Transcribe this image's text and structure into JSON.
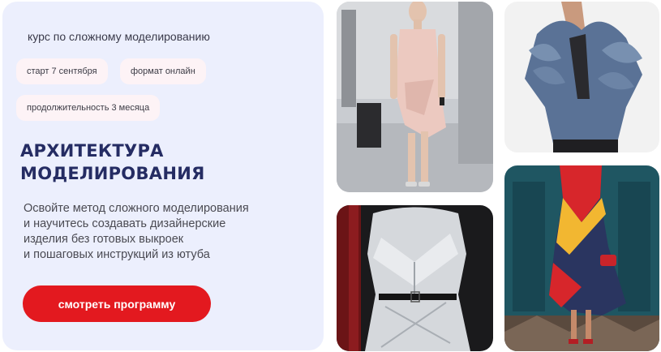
{
  "promo": {
    "subtitle": "курс по сложному моделированию",
    "chips": {
      "start": "старт 7 сентября",
      "format": "формат онлайн",
      "duration": "продолжительность 3 месяца"
    },
    "title_line1": "АРХИТЕКТУРА",
    "title_line2": "МОДЕЛИРОВАНИЯ",
    "description": {
      "line1": "Освойте метод сложного моделирования",
      "line2": "и научитесь создавать дизайнерские",
      "line3": "изделия без готовых выкроек",
      "line4": "и пошаговых инструкций из ютуба"
    },
    "cta_label": "смотреть программу"
  },
  "colors": {
    "card_background": "#eceffd",
    "chip_background": "#fdf3f6",
    "title": "#252c63",
    "cta": "#e3191f"
  }
}
